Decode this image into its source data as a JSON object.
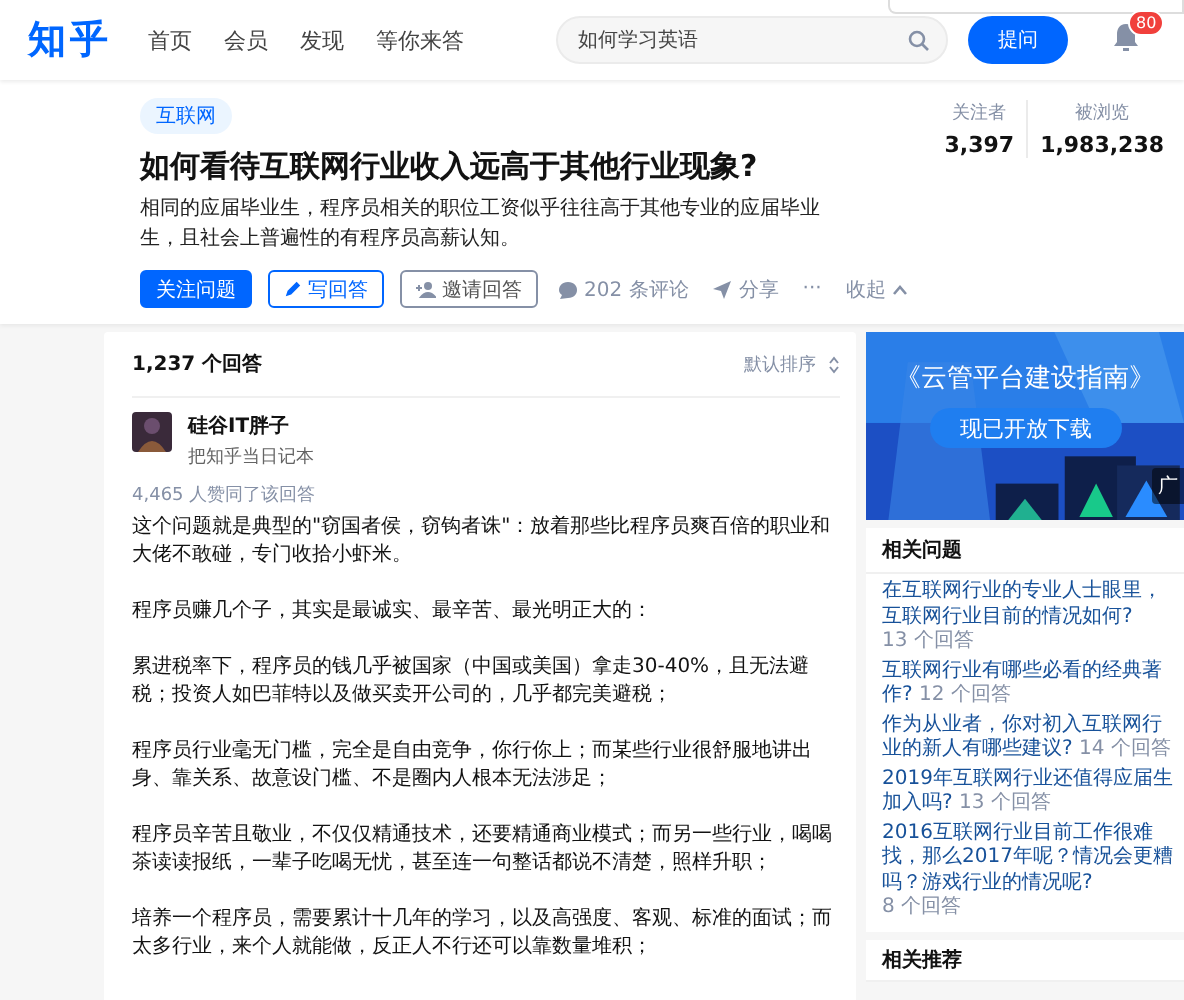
{
  "header": {
    "logo": "知乎",
    "nav": [
      {
        "label": "首页",
        "selected": false
      },
      {
        "label": "会员",
        "selected": false
      },
      {
        "label": "发现",
        "selected": false
      },
      {
        "label": "等你来答",
        "selected": false
      }
    ],
    "search": {
      "value": "如何学习英语"
    },
    "ask_button": "提问",
    "notification_badge": "80"
  },
  "question": {
    "tag": "互联网",
    "title": "如何看待互联网行业收入远高于其他行业现象?",
    "description": "相同的应届毕业生，程序员相关的职位工资似乎往往高于其他专业的应届毕业生，且社会上普遍性的有程序员高薪认知。",
    "stats": [
      {
        "label": "关注者",
        "value": "3,397"
      },
      {
        "label": "被浏览",
        "value": "1,983,238"
      }
    ],
    "actions": [
      {
        "kind": "primary",
        "label": "关注问题"
      },
      {
        "kind": "write",
        "label": "写回答"
      },
      {
        "kind": "invite",
        "label": "邀请回答"
      },
      {
        "kind": "comment",
        "label": "202 条评论"
      },
      {
        "kind": "share",
        "label": "分享"
      },
      {
        "kind": "more",
        "label": "···"
      },
      {
        "kind": "collapse",
        "label": "收起"
      }
    ]
  },
  "answers": {
    "count": "1,237 个回答",
    "sort": "默认排序",
    "author": {
      "name": "硅谷IT胖子",
      "bio": "把知乎当日记本"
    },
    "votes": "4,465 人赞同了该回答",
    "paragraphs": [
      "这个问题就是典型的\"窃国者侯，窃钩者诛\"：放着那些比程序员爽百倍的职业和大佬不敢碰，专门收拾小虾米。",
      "程序员赚几个子，其实是最诚实、最辛苦、最光明正大的：",
      "累进税率下，程序员的钱几乎被国家（中国或美国）拿走30-40%，且无法避税；投资人如巴菲特以及做买卖开公司的，几乎都完美避税；",
      "程序员行业毫无门槛，完全是自由竞争，你行你上；而某些行业很舒服地讲出身、靠关系、故意设门槛、不是圈内人根本无法涉足；",
      "程序员辛苦且敬业，不仅仅精通技术，还要精通商业模式；而另一些行业，喝喝茶读读报纸，一辈子吃喝无忧，甚至连一句整话都说不清楚，照样升职；",
      "培养一个程序员，需要累计十几年的学习，以及高强度、客观、标准的面试；而太多行业，来个人就能做，反正人不行还可以靠数量堆积；"
    ]
  },
  "sidebar": {
    "ad": {
      "title": "《云管平台建设指南》",
      "button": "现已开放下载",
      "label": "广"
    },
    "related": {
      "title": "相关问题",
      "items": [
        {
          "question": "在互联网行业的专业人士眼里，互联网行业目前的情况如何?",
          "answers": "13 个回答"
        },
        {
          "question": "互联网行业有哪些必看的经典著作?",
          "answers": "12 个回答"
        },
        {
          "question": "作为从业者，你对初入互联网行业的新人有哪些建议?",
          "answers": "14 个回答"
        },
        {
          "question": "2019年互联网行业还值得应届生加入吗?",
          "answers": "13 个回答"
        },
        {
          "question": "2016互联网行业目前工作很难找，那么2017年呢？情况会更糟吗？游戏行业的情况呢?",
          "answers": "8 个回答"
        }
      ]
    },
    "recommend_title": "相关推荐"
  }
}
